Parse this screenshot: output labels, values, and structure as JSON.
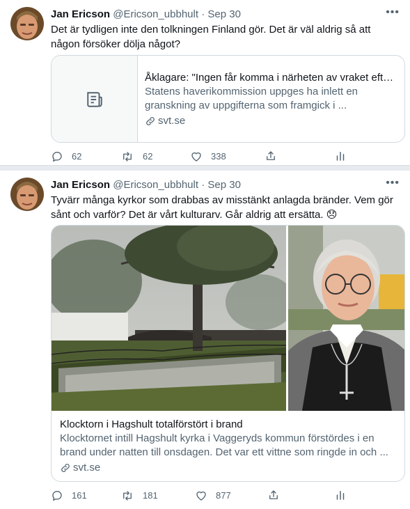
{
  "colors": {
    "secondary": "#536471",
    "border": "#cfd9de",
    "text": "#0f1419",
    "separator": "#e7eaee"
  },
  "tweets": [
    {
      "name": "Jan Ericson",
      "handle": "@Ericson_ubbhult",
      "dot": "·",
      "date": "Sep 30",
      "more": "•••",
      "text": "Det är tydligen inte den tolkningen Finland gör. Det är väl aldrig så att någon försöker dölja något?",
      "card": {
        "thumb_icon": "article-icon",
        "title": "Åklagare: \"Ingen får komma i närheten av vraket efte...",
        "description": "Statens haverikommission uppges ha inlett en granskning av uppgifterna som framgick i ...",
        "domain": "svt.se"
      },
      "actions": {
        "replies": "62",
        "retweets": "62",
        "likes": "338"
      }
    },
    {
      "name": "Jan Ericson",
      "handle": "@Ericson_ubbhult",
      "dot": "·",
      "date": "Sep 30",
      "more": "•••",
      "text": "Tyvärr många kyrkor som drabbas av misstänkt anlagda bränder. Vem gör sånt och varför? Det är vårt kulturarv. Går aldrig att ersätta. 😞",
      "card": {
        "title": "Klocktorn i Hagshult totalförstört i brand",
        "description": "Klocktornet intill Hagshult kyrka i Vaggeryds kommun förstördes i en brand under natten till onsdagen. Det var ett vittne som ringde in och ...",
        "domain": "svt.se"
      },
      "actions": {
        "replies": "161",
        "retweets": "181",
        "likes": "877"
      }
    }
  ]
}
